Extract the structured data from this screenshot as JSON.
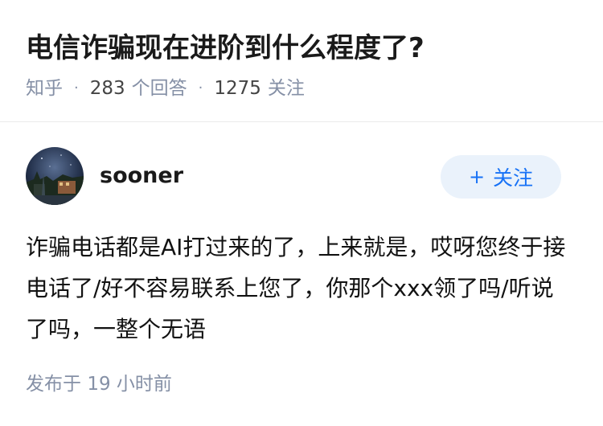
{
  "question": {
    "title": "电信诈骗现在进阶到什么程度了?",
    "site": "知乎",
    "answers_count": "283",
    "answers_label": "个回答",
    "followers_count": "1275",
    "followers_label": "关注"
  },
  "author": {
    "name": "sooner",
    "avatar_icon": "avatar-photo",
    "follow_label": "关注"
  },
  "answer": {
    "text": "诈骗电话都是AI打过来的了，上来就是，哎呀您终于接电话了/好不容易联系上您了，你那个xxx领了吗/听说了吗，一整个无语",
    "publish_prefix": "发布于",
    "publish_count": "19",
    "publish_suffix": "小时前"
  },
  "colors": {
    "accent": "#1772f6",
    "follow_bg": "#eaf2fb",
    "meta_text": "#8590a6"
  }
}
